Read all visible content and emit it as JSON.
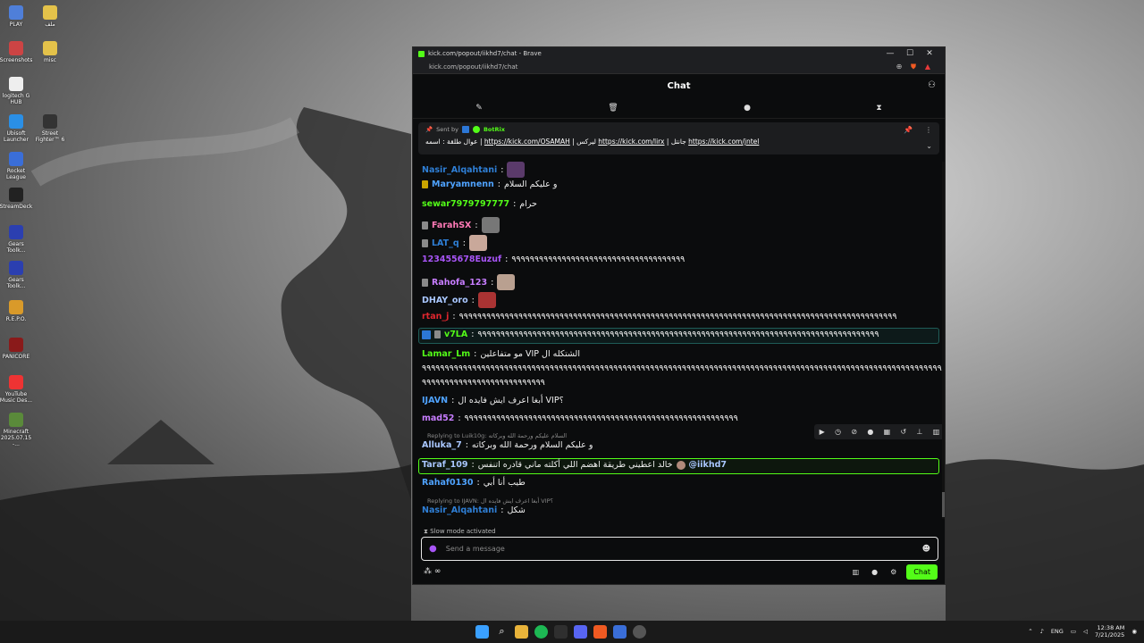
{
  "desktop": {
    "icons": [
      {
        "label": "PLAY",
        "color": "#4f7fd9"
      },
      {
        "label": "Screenshots",
        "color": "#c44"
      },
      {
        "label": "logitech G HUB",
        "color": "#eee"
      },
      {
        "label": "Ubisoft Launcher",
        "color": "#2a8fe6"
      },
      {
        "label": "Rocket League",
        "color": "#3a6ed8"
      },
      {
        "label": "StreamDeck",
        "color": "#222"
      },
      {
        "label": "Gears Toolk...",
        "color": "#2b3fb0"
      },
      {
        "label": "Gears Toolk...",
        "color": "#2b3fb0"
      },
      {
        "label": "R.E.P.O.",
        "color": "#d99a2a"
      },
      {
        "label": "PANICORE",
        "color": "#8a1a1a"
      },
      {
        "label": "YouTube Music Des...",
        "color": "#e33"
      },
      {
        "label": "Minecraft 2025.07.15 -...",
        "color": "#5a8a3a"
      },
      {
        "label": "ملف",
        "color": "#e4c24a"
      },
      {
        "label": "misc",
        "color": "#e4c24a"
      },
      {
        "label": "Street Fighter™ 6",
        "color": "#333"
      }
    ]
  },
  "browser": {
    "title": "kick.com/popout/iikhd7/chat - Brave",
    "url": "kick.com/popout/iikhd7/chat",
    "minimize": "—",
    "maximize": "☐",
    "close": "✕"
  },
  "chat": {
    "header_title": "Chat",
    "pinned": {
      "sent_by_label": "Sent by",
      "bot_name": "BotRix",
      "text_prefix": "عوال طلقة : اسمه |",
      "link1": "https://kick.com/OSAMAH",
      "mid1": "| ليركس",
      "link2": "https://kick.com/lirx",
      "mid2": "| جانتل",
      "link3": "https://kick.com/jntel"
    },
    "messages": [
      {
        "user": "Nasir_Alqahtani",
        "color": "#2f7fd6",
        "text": "",
        "emote": "#5a3a6a",
        "badge": ""
      },
      {
        "user": "Maryamnenn",
        "color": "#4fa3ff",
        "text": "و عليكم السلام",
        "emote": "",
        "badge": "#caa400"
      },
      {
        "user": "sewar7979797777",
        "color": "#53fc18",
        "text": "حرام",
        "emote": "",
        "badge": ""
      },
      {
        "user": "FarahSX",
        "color": "#ff7ab6",
        "text": "",
        "emote": "#777",
        "badge": "#8a8a8a"
      },
      {
        "user": "LAT_q",
        "color": "#2f7fd6",
        "text": "",
        "emote": "#c9a89a",
        "badge": "#8a8a8a"
      },
      {
        "user": "123455678Euzuf",
        "color": "#a855f7",
        "text": "٩٩٩٩٩٩٩٩٩٩٩٩٩٩٩٩٩٩٩٩٩٩٩٩٩٩٩٩٩٩٩٩٩٩٩٩٩٩",
        "emote": "",
        "badge": ""
      },
      {
        "user": "Rahofa_123",
        "color": "#c77dff",
        "text": "",
        "emote": "#b9a090",
        "badge": "#8a8a8a"
      },
      {
        "user": "DHAY_oro",
        "color": "#a9c7ff",
        "text": "",
        "emote": "#a33",
        "badge": ""
      },
      {
        "user": "rtan_j",
        "color": "#e0262e",
        "text": "٩٩٩٩٩٩٩٩٩٩٩٩٩٩٩٩٩٩٩٩٩٩٩٩٩٩٩٩٩٩٩٩٩٩٩٩٩٩٩٩٩٩٩٩٩٩٩٩٩٩٩٩٩٩٩٩٩٩٩٩٩٩٩٩٩٩٩٩٩٩٩٩٩٩٩٩٩٩٩٩٩٩٩٩٩٩٩٩٩٩٩٩٩٩٩٩",
        "emote": "",
        "badge": ""
      },
      {
        "user": "v7LA",
        "color": "#53fc18",
        "text": "٩٩٩٩٩٩٩٩٩٩٩٩٩٩٩٩٩٩٩٩٩٩٩٩٩٩٩٩٩٩٩٩٩٩٩٩٩٩٩٩٩٩٩٩٩٩٩٩٩٩٩٩٩٩٩٩٩٩٩٩٩٩٩٩٩٩٩٩٩٩٩٩٩٩٩٩٩٩٩٩٩٩٩٩٩٩٩٩",
        "emote": "",
        "badge": "#8a8a8a"
      },
      {
        "user": "Lamar_Lm",
        "color": "#53fc18",
        "text": "مو متفاعلين VIP الشتكله ال",
        "emote": "",
        "badge": ""
      },
      {
        "user": "",
        "color": "#fff",
        "text": "٩٩٩٩٩٩٩٩٩٩٩٩٩٩٩٩٩٩٩٩٩٩٩٩٩٩٩٩٩٩٩٩٩٩٩٩٩٩٩٩٩٩٩٩٩٩٩٩٩٩٩٩٩٩٩٩٩٩٩٩٩٩٩٩٩٩٩٩٩٩٩٩٩٩٩٩٩٩٩٩٩٩٩٩٩٩٩٩٩٩٩٩٩٩٩٩٩٩٩٩٩٩٩٩٩٩٩٩٩٩٩٩٩٩٩٩٩٩٩٩٩٩٩",
        "emote": "",
        "badge": ""
      },
      {
        "user": "",
        "color": "#fff",
        "text": "٩٩٩٩٩٩٩٩٩٩٩٩٩٩٩٩٩٩٩٩٩٩٩٩٩٩٩",
        "emote": "",
        "badge": ""
      },
      {
        "user": "IJAVN",
        "color": "#4fa3ff",
        "text": "أبغا اعرف ايش فايده ال VIP؟",
        "emote": "",
        "badge": ""
      },
      {
        "user": "mad52",
        "color": "#c77dff",
        "text": "٩٩٩٩٩٩٩٩٩٩٩٩٩٩٩٩٩٩٩٩٩٩٩٩٩٩٩٩٩٩٩٩٩٩٩٩٩٩٩٩٩٩٩٩٩٩٩٩٩٩٩٩٩٩٩٩٩٩٩٩",
        "emote": "",
        "badge": ""
      },
      {
        "user": "Alluka_7",
        "color": "#a9c7ff",
        "text": "و عليكم السلام ورحمة الله وبركاته",
        "emote": "",
        "badge": "",
        "reply": "Replying to Luik10g: السلام عليكم ورحمة الله وبركاته"
      },
      {
        "user": "Taraf_109",
        "color": "#a9c7ff",
        "text": "خالد اعطيني طريقة اهضم اللي أكلته ماني قادره اتنفس",
        "emote": "",
        "badge": "",
        "mention": "@iikhd7"
      },
      {
        "user": "Rahaf0130",
        "color": "#4fa3ff",
        "text": "طيب أنا أبي",
        "emote": "",
        "badge": ""
      },
      {
        "user": "Nasir_Alqahtani",
        "color": "#2f7fd6",
        "text": "شكل",
        "emote": "",
        "badge": "",
        "reply": "Replying to IJAVN: أبغا اعرف ايش فايده ال VIP؟"
      }
    ],
    "slow_mode": "Slow mode activated",
    "composer_placeholder": "Send a message",
    "chat_button": "Chat"
  },
  "taskbar": {
    "lang": "ENG",
    "time": "12:38 AM",
    "date": "7/21/2025"
  }
}
